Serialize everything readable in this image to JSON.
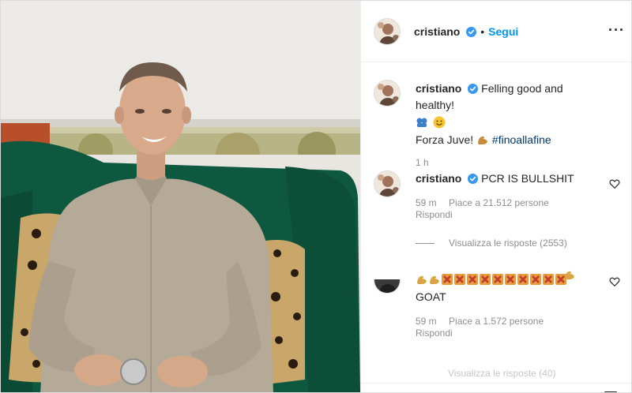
{
  "header": {
    "username": "cristiano",
    "separator": "•",
    "follow_label": "Segui",
    "more_label": "···"
  },
  "caption": {
    "username": "cristiano",
    "text_line1": "Felling good and healthy!",
    "text_line2_prefix": "Forza Juve!",
    "hashtag": "#finoallafine",
    "time": "1 h"
  },
  "comments": [
    {
      "username": "cristiano",
      "text": "PCR IS BULLSHIT",
      "time": "59 m",
      "likes": "Piace a 21.512 persone",
      "reply_label": "Rispondi",
      "view_replies": "Visualizza le risposte (2553)"
    },
    {
      "username": "",
      "text": "GOAT",
      "time": "59 m",
      "likes": "Piace a 1.572 persone",
      "reply_label": "Rispondi",
      "view_replies": "Visualizza le risposte (40)"
    }
  ],
  "icons": {
    "verified": "verified-badge-icon",
    "heart": "heart-icon",
    "comment": "comment-icon",
    "share": "share-icon",
    "bookmark": "bookmark-icon"
  },
  "colors": {
    "link_blue": "#0095f6",
    "verified_blue": "#3897f0",
    "muted_text": "#8e8e8e",
    "text": "#262626",
    "sofa_green": "#0f5840"
  }
}
